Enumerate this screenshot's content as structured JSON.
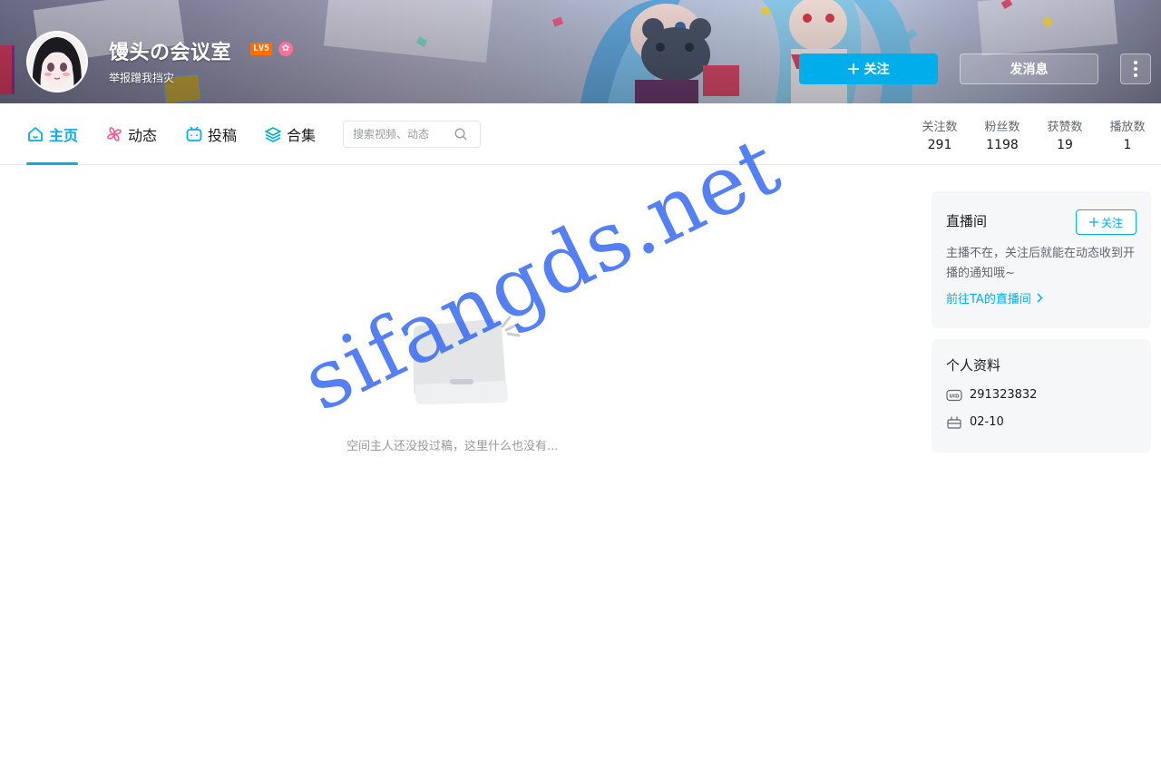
{
  "banner": {
    "username": "馒头の会议室",
    "level": "LV5",
    "signature": "举报蹭我挡灾",
    "follow_label": "关注",
    "message_label": "发消息"
  },
  "nav": {
    "tabs": [
      {
        "label": "主页",
        "icon": "home-icon",
        "active": true
      },
      {
        "label": "动态",
        "icon": "pinwheel-icon",
        "active": false
      },
      {
        "label": "投稿",
        "icon": "tv-icon",
        "active": false
      },
      {
        "label": "合集",
        "icon": "layers-icon",
        "active": false
      }
    ],
    "search_placeholder": "搜索视频、动态"
  },
  "stats": [
    {
      "label": "关注数",
      "value": "291"
    },
    {
      "label": "粉丝数",
      "value": "1198"
    },
    {
      "label": "获赞数",
      "value": "19"
    },
    {
      "label": "播放数",
      "value": "1"
    }
  ],
  "empty": {
    "text": "空间主人还没投过稿，这里什么也没有..."
  },
  "live_card": {
    "title": "直播间",
    "follow_label": "关注",
    "description": "主播不在，关注后就能在动态收到开播的通知哦~",
    "link_label": "前往TA的直播间"
  },
  "profile_card": {
    "title": "个人资料",
    "uid": "291323832",
    "birthday": "02-10"
  },
  "watermark": "sifangds.net",
  "colors": {
    "accent": "#00aeec",
    "text_primary": "#18191c",
    "text_secondary": "#61666d",
    "text_muted": "#9499a0",
    "card_bg": "#f6f7f8",
    "level_badge": "#ff6c00",
    "vip_pink": "#fb7299"
  }
}
